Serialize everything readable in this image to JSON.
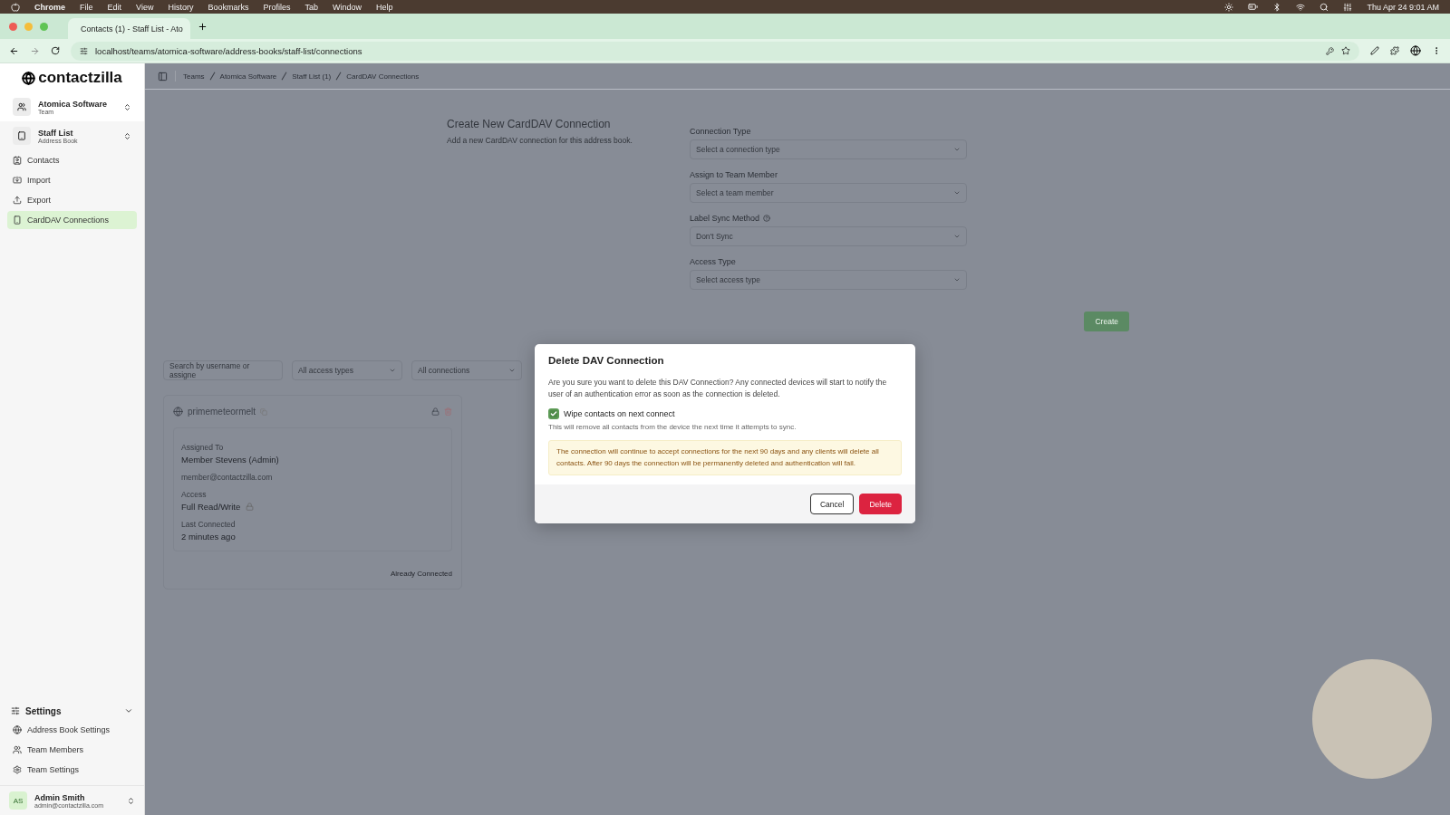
{
  "menu_bar": {
    "app": "Chrome",
    "items": [
      "File",
      "Edit",
      "View",
      "History",
      "Bookmarks",
      "Profiles",
      "Tab",
      "Window",
      "Help"
    ],
    "clock": "Thu Apr 24  9:01 AM"
  },
  "browser": {
    "tab_title": "Contacts (1) - Staff List - Ato",
    "url": "localhost/teams/atomica-software/address-books/staff-list/connections"
  },
  "sidebar": {
    "logo": "contactzilla",
    "team": {
      "name": "Atomica Software",
      "sub": "Team"
    },
    "book": {
      "name": "Staff List",
      "sub": "Address Book"
    },
    "nav": [
      {
        "label": "Contacts",
        "selected": false,
        "kind": "contacts"
      },
      {
        "label": "Import",
        "selected": false,
        "kind": "import"
      },
      {
        "label": "Export",
        "selected": false,
        "kind": "export"
      },
      {
        "label": "CardDAV Connections",
        "selected": true,
        "kind": "device"
      }
    ],
    "settings": {
      "label": "Settings",
      "expanded": true,
      "items": [
        {
          "label": "Address Book Settings",
          "kind": "globe"
        },
        {
          "label": "Team Members",
          "kind": "users"
        },
        {
          "label": "Team Settings",
          "kind": "gear"
        }
      ]
    },
    "user": {
      "initials": "AS",
      "name": "Admin Smith",
      "email": "admin@contactzilla.com"
    }
  },
  "breadcrumbs": [
    "Teams",
    "Atomica Software",
    "Staff List (1)",
    "CardDAV Connections"
  ],
  "form": {
    "title": "Create New CardDAV Connection",
    "subtitle": "Add a new CardDAV connection for this address book.",
    "fields": [
      {
        "label": "Connection Type",
        "placeholder": "Select a connection type",
        "help": false
      },
      {
        "label": "Assign to Team Member",
        "placeholder": "Select a team member",
        "help": false
      },
      {
        "label": "Label Sync Method",
        "placeholder": "Don't Sync",
        "help": true
      },
      {
        "label": "Access Type",
        "placeholder": "Select access type",
        "help": false
      }
    ],
    "button": "Create"
  },
  "filters": {
    "search_placeholder": "Search by username or assigne",
    "selects": [
      "All access types",
      "All connections"
    ]
  },
  "connection": {
    "name": "primemeteormelt",
    "assigned_label": "Assigned To",
    "assigned_name": "Member Stevens (Admin)",
    "email": "member@contactzilla.com",
    "access_label": "Access",
    "access": "Full Read/Write",
    "last_label": "Last Connected",
    "last": "2 minutes ago",
    "status": "Already Connected"
  },
  "dialog": {
    "title": "Delete DAV Connection",
    "message": "Are you sure you want to delete this DAV Connection? Any connected devices will start to notify the user of an authentication error as soon as the connection is deleted.",
    "checkbox": {
      "label": "Wipe contacts on next connect",
      "checked": true,
      "hint": "This will remove all contacts from the device the next time it attempts to sync."
    },
    "warning": "The connection will continue to accept connections for the next 90 days and any clients will delete all contacts. After 90 days the connection will be permanently deleted and authentication will fail.",
    "buttons": [
      {
        "label": "Cancel",
        "kind": "secondary"
      },
      {
        "label": "Delete",
        "kind": "danger"
      }
    ]
  }
}
